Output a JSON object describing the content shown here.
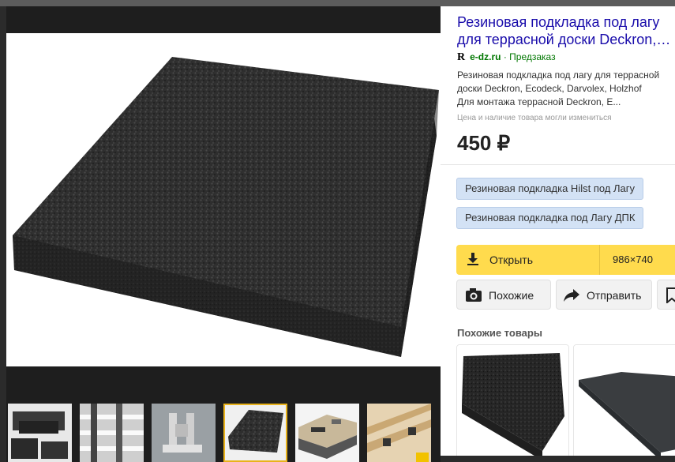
{
  "product": {
    "title_line1": "Резиновая подкладка под лагу",
    "title_line2": "для террасной доски Deckron,…",
    "source_icon": "R",
    "source_host": "e-dz.ru",
    "source_separator": "·",
    "source_status": "Предзаказ",
    "description_lines": [
      "Резиновая подкладка под лагу для террасной",
      "доски Deckron, Ecodeck, Darvolex, Holzhof",
      "Для монтажа террасной Deckron, E..."
    ],
    "price_note": "Цена и наличие товара могли измениться",
    "price": "450 ₽"
  },
  "tags": [
    "Резиновая подкладка Hilst под Лагу",
    "Резиновая подкладка под Лагу ДПК"
  ],
  "actions": {
    "open_label": "Открыть",
    "image_size": "986×740",
    "similar_label": "Похожие",
    "share_label": "Отправить"
  },
  "similar_products_title": "Похожие товары",
  "icons": {
    "download": "download-icon",
    "camera": "camera-search-icon",
    "share": "share-arrow-icon",
    "bookmark": "bookmark-icon",
    "size_spin": "up-down-arrows-icon"
  },
  "colors": {
    "accent_yellow": "#ffdb4d",
    "link_blue": "#1a0dab",
    "source_green": "#007700",
    "tag_blue": "#d3e2f5",
    "active_thumb": "#e9b31c"
  }
}
